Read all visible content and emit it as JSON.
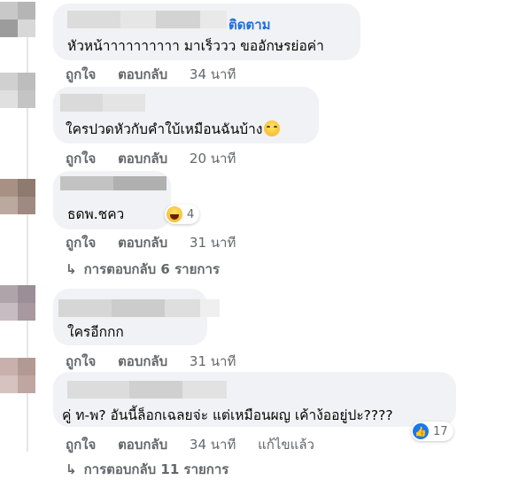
{
  "comments": [
    {
      "follow_label": "ติดตาม",
      "text": "หัวหน้าาาาาาาาาา มาเร็ววว ขออักษรย่อค่า",
      "like_label": "ถูกใจ",
      "reply_label": "ตอบกลับ",
      "time": "34 นาที"
    },
    {
      "text": "ใครปวดหัวกับคำใบ้เหมือนฉันบ้าง",
      "emoji_icon": "grinning-sweat-emoji-icon",
      "like_label": "ถูกใจ",
      "reply_label": "ตอบกลับ",
      "time": "20 นาที"
    },
    {
      "text": "ธดพ.ชคว",
      "like_label": "ถูกใจ",
      "reply_label": "ตอบกลับ",
      "time": "31 นาที",
      "reaction": {
        "icon": "haha-reaction-icon",
        "count": "4"
      },
      "replies_label": "การตอบกลับ 6 รายการ"
    },
    {
      "text": "ใครอีกกก",
      "like_label": "ถูกใจ",
      "reply_label": "ตอบกลับ",
      "time": "31 นาที"
    },
    {
      "text": "คู่ ท-พ? อันนี้ล็อกเฉลยจ่ะ แต่เหมือนผญ เค้าง้ออยู่ปะ????",
      "like_label": "ถูกใจ",
      "reply_label": "ตอบกลับ",
      "time": "34 นาที",
      "edited_label": "แก้ไขแล้ว",
      "reaction": {
        "icon": "like-reaction-icon",
        "count": "17"
      },
      "replies_label": "การตอบกลับ 11 รายการ"
    }
  ],
  "colors": {
    "bubble": "#f0f2f5",
    "meta_text": "#65676b",
    "link_blue": "#216fdb",
    "like_blue": "#1877f2"
  }
}
